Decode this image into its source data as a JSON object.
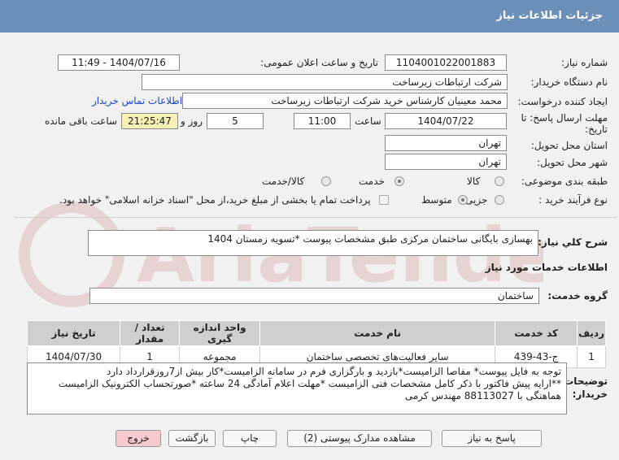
{
  "header": {
    "title": "جزئیات اطلاعات نیاز"
  },
  "labels": {
    "need_number": "شماره نیاز:",
    "announce_datetime": "تاریخ و ساعت اعلان عمومی:",
    "buyer_org": "نام دستگاه خریدار:",
    "requester": "ایجاد کننده درخواست:",
    "buyer_contact": "اطلاعات تماس خریدار",
    "deadline_line1": "مهلت ارسال پاسخ: تا",
    "deadline_line2": "تاریخ:",
    "hour": "ساعت",
    "day_and": "روز و",
    "remaining": "ساعت باقی مانده",
    "province": "استان محل تحویل:",
    "city": "شهر محل تحویل:",
    "subject_class": "طبقه بندی موضوعی:",
    "purchase_type": "نوع فرآیند خرید :",
    "description": "شرح کلي نياز:",
    "services_info": "اطلاعات خدمات مورد نیاز",
    "service_group": "گروه خدمت:",
    "buyer_notes_line1": "توضیحات",
    "buyer_notes_line2": "خریدار:"
  },
  "fields": {
    "need_number": "1104001022001883",
    "announce_datetime": "1404/07/16 - 11:49",
    "buyer_org": "شرکت ارتباطات زیرساخت",
    "requester": "محمد معینیان کارشناس خرید شرکت ارتباطات زیرساخت",
    "deadline_date": "1404/07/22",
    "deadline_time": "11:00",
    "days": "5",
    "remaining_time": "21:25:47",
    "province": "تهران",
    "city": "تهران",
    "description": "بهسازی بایگانی ساختمان مرکزی طبق مشخصات پیوست *تسویه زمستان 1404",
    "service_group": "ساختمان"
  },
  "subject_options": [
    {
      "label": "کالا",
      "selected": false
    },
    {
      "label": "خدمت",
      "selected": true
    },
    {
      "label": "کالا/خدمت",
      "selected": false
    }
  ],
  "purchase_options": [
    {
      "label": "جزیی",
      "selected": false
    },
    {
      "label": "متوسط",
      "selected": true
    }
  ],
  "payment_note": "پرداخت تمام یا بخشی از مبلغ خرید،از محل \"اسناد خزانه اسلامی\" خواهد بود.",
  "table": {
    "headers": [
      "ردیف",
      "کد خدمت",
      "نام خدمت",
      "واحد اندازه گیری",
      "تعداد / مقدار",
      "تاریخ نیاز"
    ],
    "rows": [
      [
        "1",
        "ج-43-439",
        "سایر فعالیت‌های تخصصی ساختمان",
        "مجموعه",
        "1",
        "1404/07/30"
      ]
    ]
  },
  "notes": [
    "توجه به فایل پیوست* مفاصا الزامیست*بازدید و بارگزاری فرم در سامانه الزامیست*کار بیش از7روزقرارداد دارد",
    "**ارایه پیش فاکتور با ذکر کامل مشخصات فنی الزامیست *مهلت اعلام آمادگی 24 ساعته *صورتحساب الکترونیک الزامیست",
    "هماهنگی با 88113027 مهندس کرمی"
  ],
  "buttons": {
    "reply": "پاسخ به نیاز",
    "view_docs": "مشاهده مدارک پیوستی (2)",
    "print": "چاپ",
    "back": "بازگشت",
    "exit": "خروج"
  },
  "watermark": {
    "text": "AriaTender.net"
  },
  "colors": {
    "header": "#6a8fb9",
    "link": "#1a46c8",
    "remaining_bg": "#f6efb6",
    "exit_btn": "#f6c9cf"
  }
}
